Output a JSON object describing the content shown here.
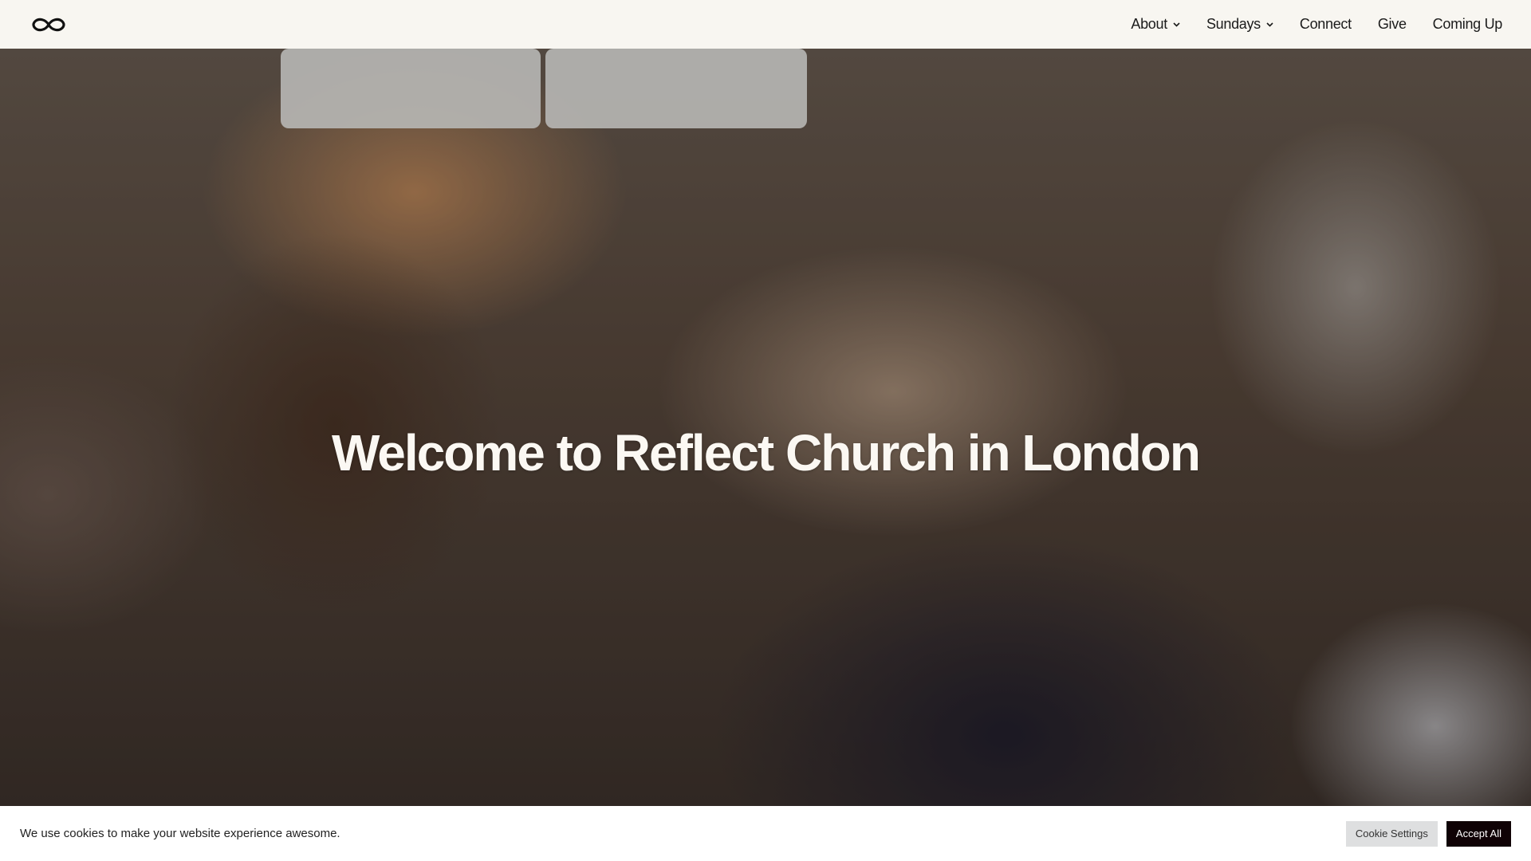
{
  "header": {
    "logo_icon": "infinity-icon",
    "nav": [
      {
        "label": "About",
        "has_dropdown": true
      },
      {
        "label": "Sundays",
        "has_dropdown": true
      },
      {
        "label": "Connect",
        "has_dropdown": false
      },
      {
        "label": "Give",
        "has_dropdown": false
      },
      {
        "label": "Coming Up",
        "has_dropdown": false
      }
    ]
  },
  "hero": {
    "title": "Welcome to Reflect Church in London"
  },
  "cookie_bar": {
    "message": "We use cookies to make your website experience awesome.",
    "settings_label": "Cookie Settings",
    "accept_label": "Accept All"
  },
  "colors": {
    "header_bg": "#f8f6f1",
    "accept_bg": "#0f0205",
    "settings_bg": "#dedfe0"
  }
}
